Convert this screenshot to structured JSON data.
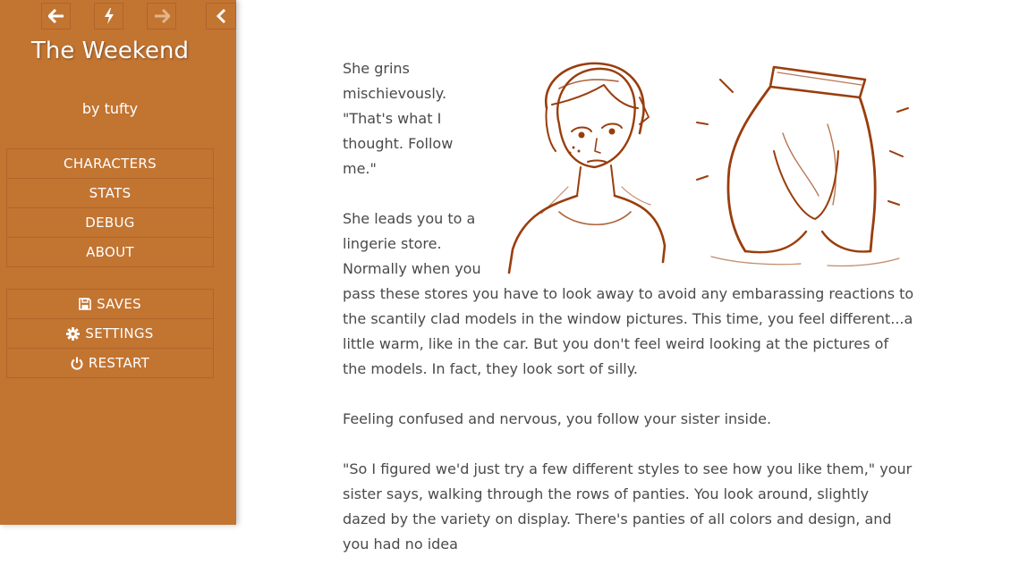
{
  "nav": {
    "back_icon": "arrow-left-icon",
    "jump_icon": "lightning-icon",
    "forward_icon": "arrow-right-icon",
    "stow_icon": "chevron-left-icon"
  },
  "story": {
    "title": "The Weekend",
    "byline": "by tufty"
  },
  "menu_story": [
    {
      "label": "CHARACTERS"
    },
    {
      "label": "STATS"
    },
    {
      "label": "DEBUG"
    },
    {
      "label": "ABOUT"
    }
  ],
  "menu_core": [
    {
      "label": "SAVES",
      "icon": "floppy-disk-icon"
    },
    {
      "label": "SETTINGS",
      "icon": "gear-icon"
    },
    {
      "label": "RESTART",
      "icon": "power-icon"
    }
  ],
  "passage": {
    "p1": "She grins mischievously. \"That's what I thought. Follow me.\"",
    "p2": "She leads you to a lingerie store. Normally when you pass these stores you have to look away to avoid any embarassing reactions to the scantily clad models in the window pictures. This time, you feel different...a little warm, like in the car. But you don't feel weird looking at the pictures of the models. In fact, they look sort of silly.",
    "p3": "Feeling confused and nervous, you follow your sister inside.",
    "p4": "\"So I figured we'd just try a few different styles to see how you like them,\" your sister says, walking through the rows of panties. You look around, slightly dazed by the variety on display. There's panties of all colors and design, and you had no idea"
  },
  "colors": {
    "sidebar": "#c27431",
    "border": "#b0652a",
    "text": "#4a4a4a",
    "sketch": "#9a3d0c"
  }
}
